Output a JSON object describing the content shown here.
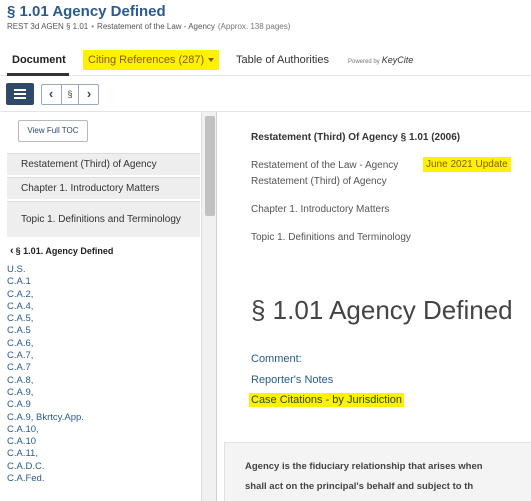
{
  "header": {
    "title": "§ 1.01 Agency Defined",
    "citation": "REST 3d AGEN § 1.01",
    "separator": "•",
    "source": "Restatement of the Law - Agency",
    "pages": "(Approx. 138 pages)"
  },
  "tabs": {
    "document": "Document",
    "citing_references": "Citing References (287)",
    "table_of_authorities": "Table of Authorities",
    "powered_by": "Powered by",
    "keycite": "KeyCite"
  },
  "toolbar": {
    "toc_icon": "list-icon",
    "prev_icon": "chevron-left-icon",
    "section_symbol": "§",
    "next_icon": "chevron-right-icon"
  },
  "sidebar": {
    "view_full_toc": "View Full TOC",
    "breadcrumbs": [
      "Restatement (Third) of Agency",
      "Chapter 1. Introductory Matters",
      "Topic 1. Definitions and Terminology"
    ],
    "current_section": "§ 1.01. Agency Defined",
    "citations": [
      "U.S.",
      "C.A.1",
      "C.A.2,",
      "C.A.4,",
      "C.A.5,",
      "C.A.5",
      "C.A.6,",
      "C.A.7,",
      "C.A.7",
      "C.A.8,",
      "C.A.9,",
      "C.A.9",
      "C.A.9, Bkrtcy.App.",
      "C.A.10,",
      "C.A.10",
      "C.A.11,",
      "C.A.D.C.",
      "C.A.Fed."
    ]
  },
  "document": {
    "heading": "Restatement (Third) Of Agency § 1.01 (2006)",
    "source_line": "Restatement of the Law - Agency",
    "update_badge": "June 2021 Update",
    "source_subline": "Restatement (Third) of Agency",
    "chapter": "Chapter 1. Introductory Matters",
    "topic": "Topic 1. Definitions and Terminology",
    "section_title": "§ 1.01 Agency Defined",
    "links": {
      "comment": "Comment:",
      "reporters_notes": "Reporter's Notes",
      "case_citations": "Case Citations - by Jurisdiction"
    },
    "body_line_1": "Agency is the fiduciary relationship that arises when",
    "body_line_2": "shall act on the principal's behalf and subject to th"
  },
  "colors": {
    "highlight": "#fff200",
    "link": "#2a5b8c",
    "toc_button": "#2f4a68"
  }
}
